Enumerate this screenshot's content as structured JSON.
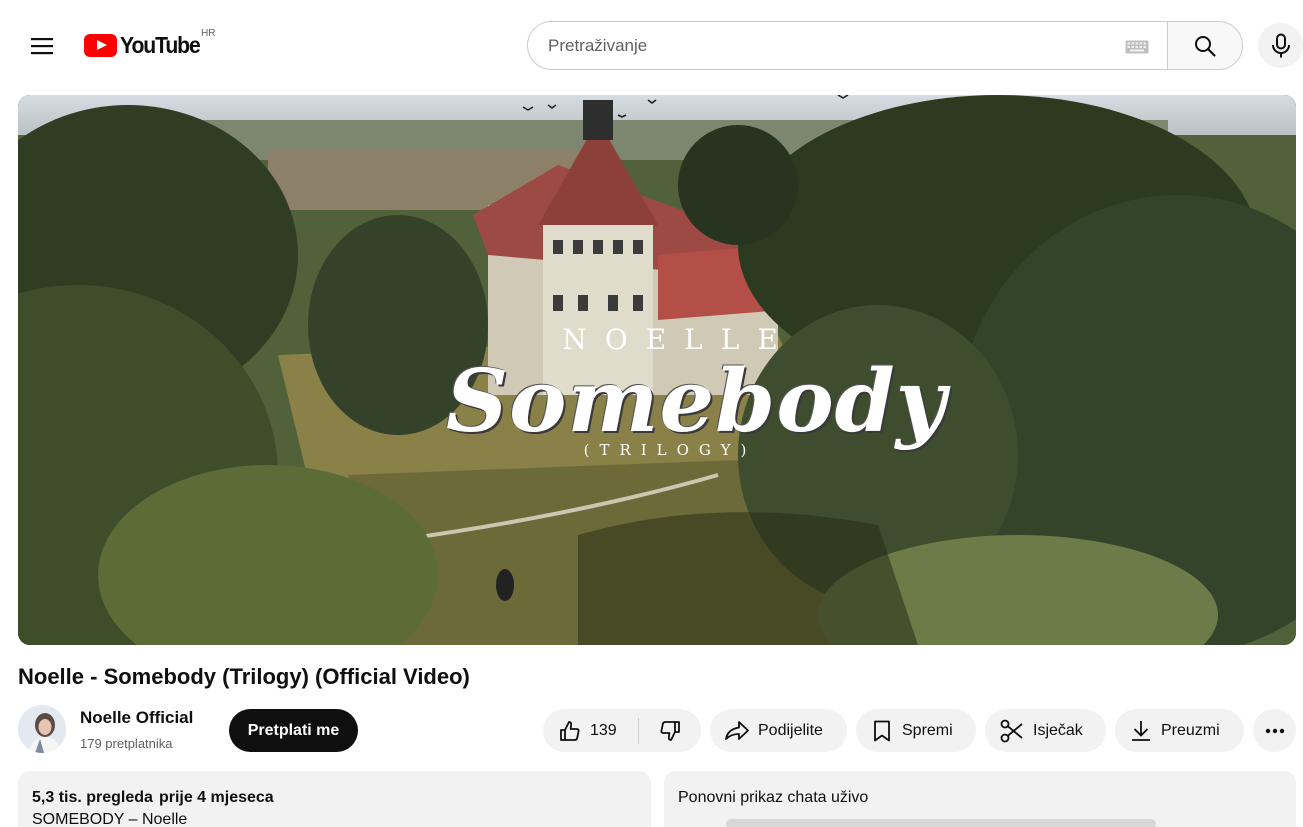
{
  "header": {
    "logo_text": "YouTube",
    "country_code": "HR",
    "search_placeholder": "Pretraživanje"
  },
  "video": {
    "overlay_artist": "NOELLE",
    "overlay_song": "Somebody",
    "overlay_subtitle": "(TRILOGY)",
    "title": "Noelle - Somebody (Trilogy) (Official Video)"
  },
  "channel": {
    "name": "Noelle Official",
    "subscribers": "179 pretplatnika",
    "subscribe_label": "Pretplati me"
  },
  "actions": {
    "like_count": "139",
    "share_label": "Podijelite",
    "save_label": "Spremi",
    "clip_label": "Isječak",
    "download_label": "Preuzmi"
  },
  "description": {
    "views": "5,3 tis. pregleda",
    "age": "prije 4 mjeseca",
    "first_line": "SOMEBODY – Noelle"
  },
  "chat": {
    "title": "Ponovni prikaz chata uživo"
  },
  "colors": {
    "brand_red": "#ff0000",
    "subscribe_bg": "#0f0f0f",
    "pill_bg": "#f2f2f2"
  },
  "icons": {
    "menu": "hamburger-menu-icon",
    "search": "search-icon",
    "keyboard": "keyboard-icon",
    "mic": "microphone-icon",
    "like": "thumbs-up-icon",
    "dislike": "thumbs-down-icon",
    "share": "share-arrow-icon",
    "save": "bookmark-icon",
    "clip": "scissors-icon",
    "download": "download-icon",
    "more": "more-horizontal-icon"
  }
}
